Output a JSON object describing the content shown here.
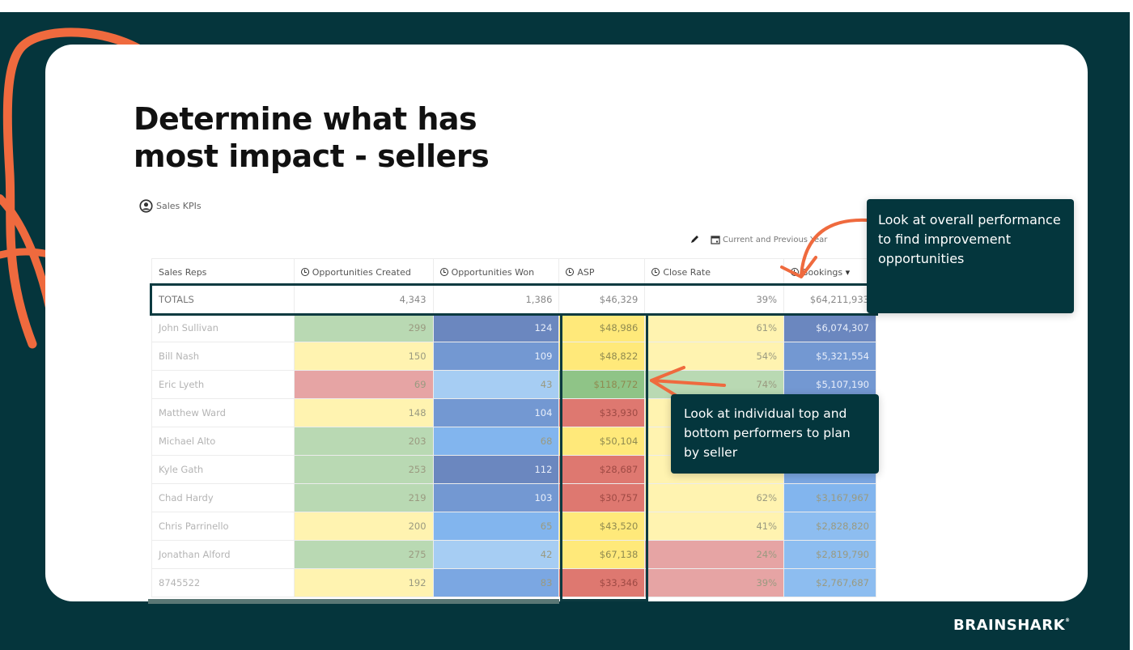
{
  "slide": {
    "title_line1": "Determine what has",
    "title_line2_regular": "most impact - ",
    "title_line2_bold": "sellers",
    "brand": "BRAINSHARK",
    "brand_mark": "®"
  },
  "dashboard": {
    "label": "Sales KPIs",
    "date_filter": "Current and Previous Year",
    "columns": [
      "Sales Reps",
      "Opportunities Created",
      "Opportunities Won",
      "ASP",
      "Close Rate",
      "Bookings"
    ],
    "sort_indicator": "▾",
    "totals": {
      "name": "TOTALS",
      "created": "4,343",
      "won": "1,386",
      "asp": "$46,329",
      "close_rate": "39%",
      "bookings": "$64,211,933"
    },
    "rows": [
      {
        "name": "John Sullivan",
        "created": "299",
        "won": "124",
        "asp": "$48,986",
        "close_rate": "61%",
        "bookings": "$6,074,307"
      },
      {
        "name": "Bill Nash",
        "created": "150",
        "won": "109",
        "asp": "$48,822",
        "close_rate": "54%",
        "bookings": "$5,321,554"
      },
      {
        "name": "Eric Lyeth",
        "created": "69",
        "won": "43",
        "asp": "$118,772",
        "close_rate": "74%",
        "bookings": "$5,107,190"
      },
      {
        "name": "Matthew Ward",
        "created": "148",
        "won": "104",
        "asp": "$33,930",
        "close_rate": "",
        "bookings": ""
      },
      {
        "name": "Michael Alto",
        "created": "203",
        "won": "68",
        "asp": "$50,104",
        "close_rate": "",
        "bookings": ""
      },
      {
        "name": "Kyle Gath",
        "created": "253",
        "won": "112",
        "asp": "$28,687",
        "close_rate": "",
        "bookings": ""
      },
      {
        "name": "Chad Hardy",
        "created": "219",
        "won": "103",
        "asp": "$30,757",
        "close_rate": "62%",
        "bookings": "$3,167,967"
      },
      {
        "name": "Chris Parrinello",
        "created": "200",
        "won": "65",
        "asp": "$43,520",
        "close_rate": "41%",
        "bookings": "$2,828,820"
      },
      {
        "name": "Jonathan Alford",
        "created": "275",
        "won": "42",
        "asp": "$67,138",
        "close_rate": "24%",
        "bookings": "$2,819,790"
      },
      {
        "name": "8745522",
        "created": "192",
        "won": "83",
        "asp": "$33,346",
        "close_rate": "39%",
        "bookings": "$2,767,687"
      }
    ],
    "cell_colors": [
      [
        "#b9d9b3",
        "#6b87bf",
        "#ffe97a",
        "#fff3b0",
        "#6b87bf"
      ],
      [
        "#fff3b0",
        "#7398d2",
        "#ffe97a",
        "#fff3b0",
        "#7398d2"
      ],
      [
        "#e6a4a4",
        "#a6cdf3",
        "#8fc487",
        "#b9d9b3",
        "#7398d2"
      ],
      [
        "#fff3b0",
        "#7398d2",
        "#de7870",
        "#fff3b0",
        "#7398d2"
      ],
      [
        "#b9d9b3",
        "#82b5ee",
        "#ffe97a",
        "#fff3b0",
        "#7ba7e2"
      ],
      [
        "#b9d9b3",
        "#6b87bf",
        "#de7870",
        "#fff3b0",
        "#7ba7e2"
      ],
      [
        "#b9d9b3",
        "#7398d2",
        "#de7870",
        "#fff3b0",
        "#82b5ee"
      ],
      [
        "#fff3b0",
        "#82b5ee",
        "#ffe97a",
        "#fff3b0",
        "#8dbdf0"
      ],
      [
        "#b9d9b3",
        "#a6cdf3",
        "#ffe97a",
        "#e6a4a4",
        "#8dbdf0"
      ],
      [
        "#fff3b0",
        "#7ba7e2",
        "#de7870",
        "#e6a4a4",
        "#8dbdf0"
      ]
    ],
    "light_text_on": [
      "#6b87bf",
      "#7398d2"
    ]
  },
  "callouts": {
    "overall": "Look at overall performance to find improvement opportunities",
    "individual": "Look at individual top and bottom performers to plan by seller"
  },
  "colors": {
    "brand_dark": "#05353c",
    "accent_orange": "#ef6a3e"
  }
}
